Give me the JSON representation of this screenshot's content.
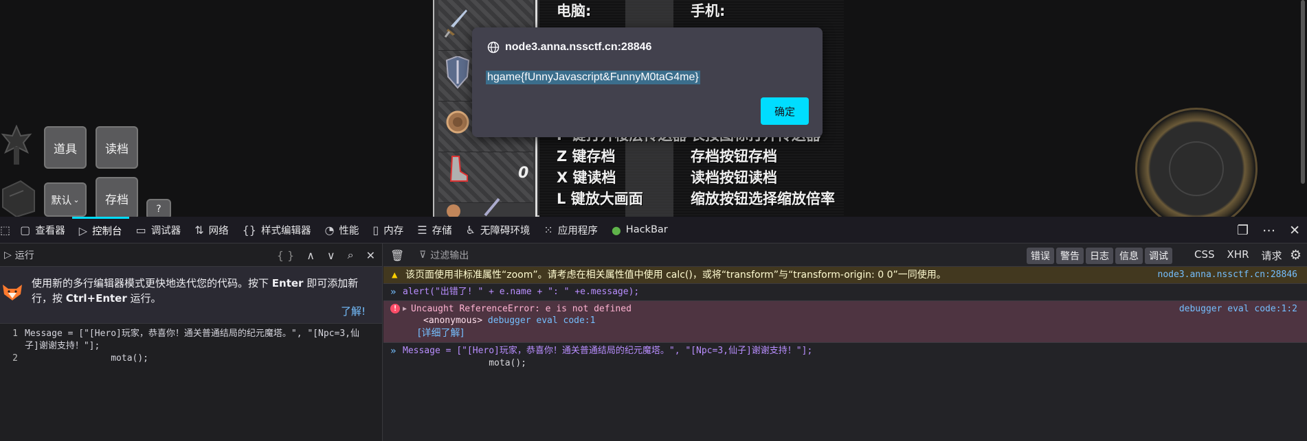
{
  "game": {
    "btn_items": "道具",
    "btn_load": "读档",
    "btn_default": "默认",
    "btn_save": "存档",
    "btn_help": "?",
    "board_lines": [
      {
        "left": "电脑:",
        "right": "手机:"
      },
      {
        "left": "F 键打开楼层传送器",
        "right": "长按图标打开传送器"
      },
      {
        "left": "Z 键存档",
        "right": "存档按钮存档"
      },
      {
        "left": "X 键读档",
        "right": "读档按钮读档"
      },
      {
        "left": "L 键放大画面",
        "right": "缩放按钮选择缩放倍率"
      }
    ],
    "counter": "0"
  },
  "alert": {
    "origin": "node3.anna.nssctf.cn:28846",
    "message": "hgame{fUnnyJavascript&FunnyM0taG4me}",
    "ok_label": "确定"
  },
  "devtools": {
    "tabs": [
      {
        "label": "查看器",
        "icon": "inspector-icon"
      },
      {
        "label": "控制台",
        "icon": "console-icon",
        "active": true
      },
      {
        "label": "调试器",
        "icon": "debugger-icon"
      },
      {
        "label": "网络",
        "icon": "network-icon"
      },
      {
        "label": "样式编辑器",
        "icon": "style-editor-icon"
      },
      {
        "label": "性能",
        "icon": "performance-icon"
      },
      {
        "label": "内存",
        "icon": "memory-icon"
      },
      {
        "label": "存储",
        "icon": "storage-icon"
      },
      {
        "label": "无障碍环境",
        "icon": "accessibility-icon"
      },
      {
        "label": "应用程序",
        "icon": "application-icon"
      },
      {
        "label": "HackBar",
        "icon": "hackbar-icon"
      }
    ],
    "editor": {
      "run_label": "运行",
      "notice_text_1": "使用新的多行编辑器模式更快地迭代您的代码。按下 ",
      "notice_key_1": "Enter",
      "notice_text_2": " 即可添加新行，按 ",
      "notice_key_2": "Ctrl+Enter",
      "notice_text_3": " 运行。",
      "learn_more": "了解!",
      "line1_num": "1",
      "line1_code": "Message = [\"[Hero]玩家，恭喜你！通关普通结局的纪元魔塔。\", \"[Npc=3,仙子]谢谢支持！\"];",
      "line2_num": "2",
      "line2_code": "                mota();"
    },
    "console": {
      "filter_placeholder": "过滤输出",
      "levels": [
        "错误",
        "警告",
        "日志",
        "信息",
        "调试"
      ],
      "selectors": [
        "CSS",
        "XHR",
        "请求"
      ],
      "warning_text": "该页面使用非标准属性“zoom”。请考虑在相关属性值中使用 calc()，或将“transform”与“transform-origin: 0 0”一同使用。",
      "warning_source": "node3.anna.nssctf.cn:28846",
      "input1": "alert(\"出错了!  \" + e.name + \": \" +e.message);",
      "error_text": "Uncaught ReferenceError: e is not defined",
      "error_frame": "<anonymous>",
      "error_frame_loc": "debugger eval code:1",
      "error_more": "[详细了解]",
      "error_source": "debugger eval code:1:2",
      "input2_line1": "Message = [\"[Hero]玩家，恭喜你！通关普通结局的纪元魔塔。\", \"[Npc=3,仙子]谢谢支持！\"];",
      "input2_line2": "                mota();"
    }
  }
}
